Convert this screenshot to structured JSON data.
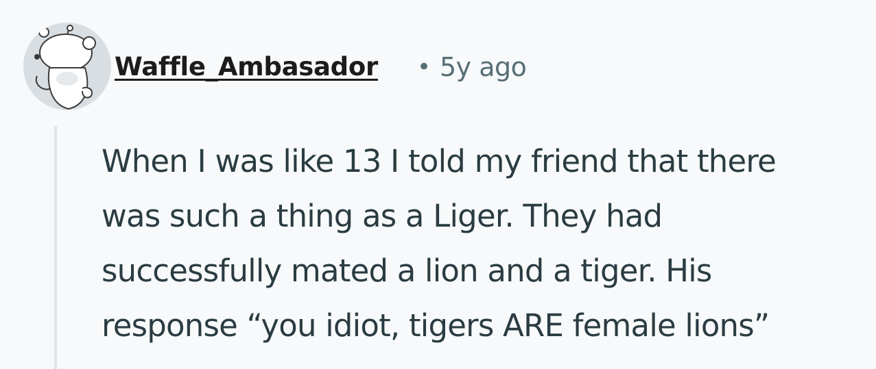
{
  "comment": {
    "author": "Waffle_Ambasador",
    "separator": "•",
    "timestamp": "5y ago",
    "avatar_icon": "snoo-avatar-icon",
    "body_lines": [
      "When I was like 13 I told my friend that there",
      "was such a thing as a Liger. They had",
      "successfully mated a lion and a tiger. His",
      "response “you idiot, tigers ARE female lions”"
    ]
  },
  "colors": {
    "background": "#f7f9fa",
    "author_text": "#1c1c1c",
    "meta_text": "#576f76",
    "body_text": "#2a3c42",
    "thread_line": "#dfe4e7",
    "avatar_bg": "#d9dee2"
  }
}
